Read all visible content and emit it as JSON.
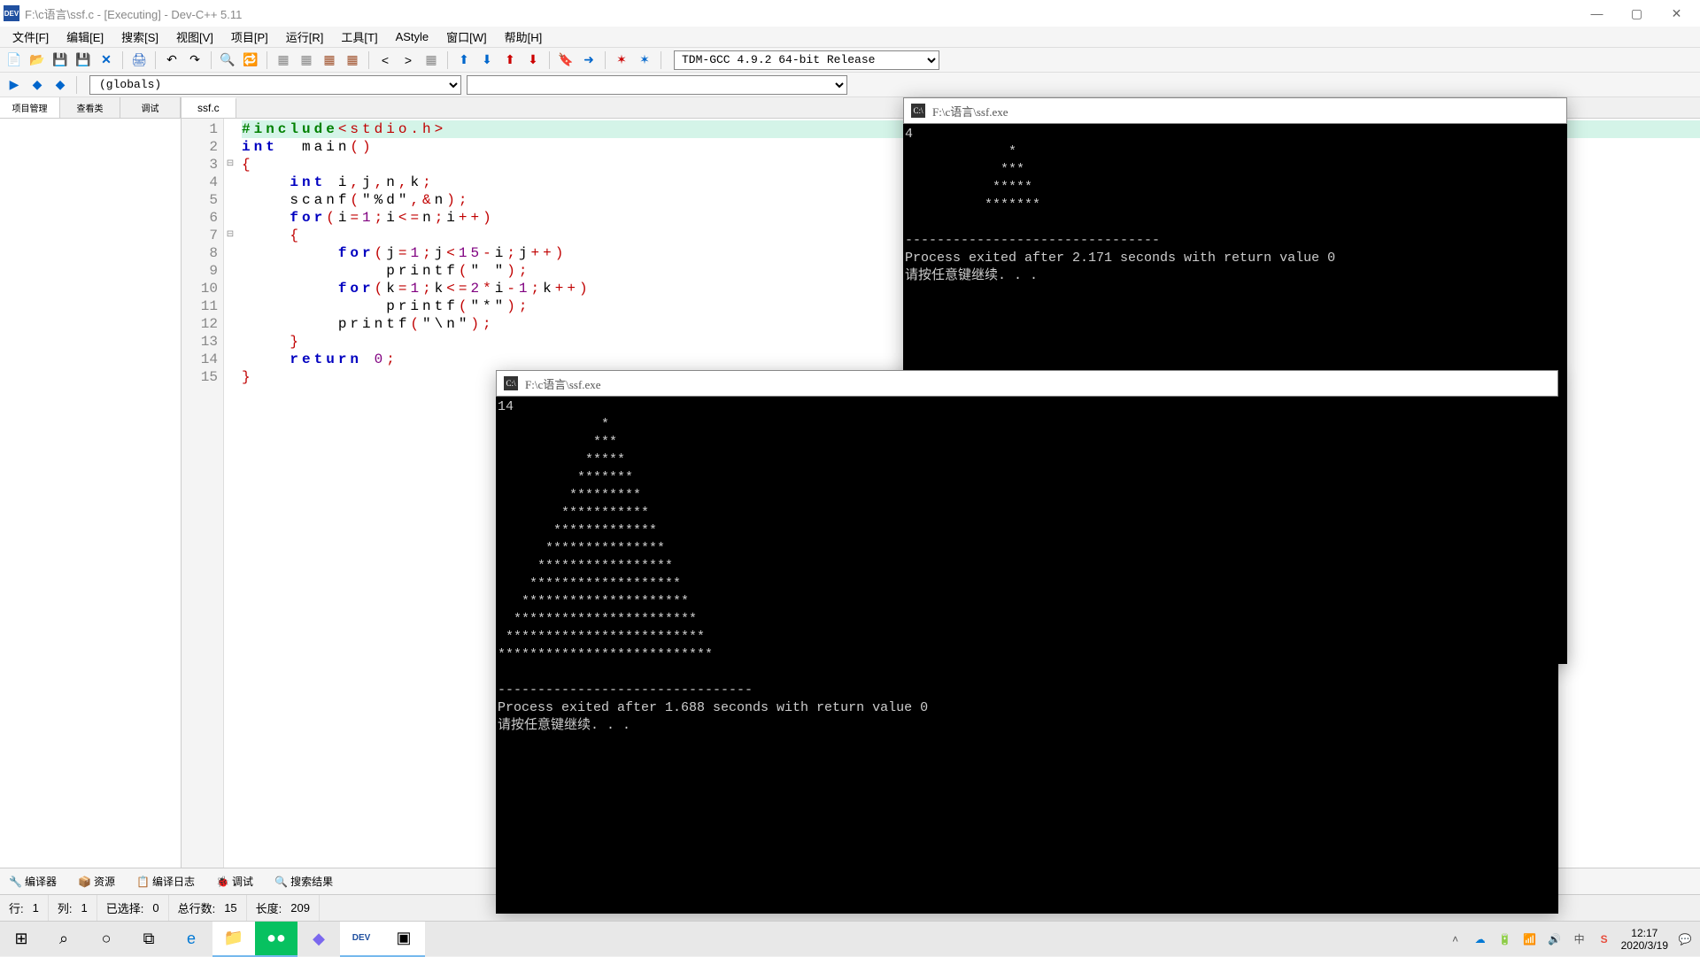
{
  "title": "F:\\c语言\\ssf.c - [Executing] - Dev-C++ 5.11",
  "menu": [
    "文件[F]",
    "编辑[E]",
    "搜索[S]",
    "视图[V]",
    "项目[P]",
    "运行[R]",
    "工具[T]",
    "AStyle",
    "窗口[W]",
    "帮助[H]"
  ],
  "compiler": "TDM-GCC 4.9.2 64-bit Release",
  "globals": "(globals)",
  "sidebar_tabs": [
    "项目管理",
    "查看类",
    "调试"
  ],
  "file_tab": "ssf.c",
  "code": {
    "lines": [
      {
        "n": 1,
        "html": "<span class='kw-green'>#include</span><span class='kw-red'>&lt;stdio.h&gt;</span>",
        "hl": true
      },
      {
        "n": 2,
        "html": "<span class='kw-blue'>int</span>  <span>main</span><span class='kw-red'>()</span>"
      },
      {
        "n": 3,
        "html": "<span class='kw-red'>{</span>",
        "fold": "⊟"
      },
      {
        "n": 4,
        "html": "    <span class='kw-blue'>int</span> i<span class='kw-red'>,</span>j<span class='kw-red'>,</span>n<span class='kw-red'>,</span>k<span class='kw-red'>;</span>"
      },
      {
        "n": 5,
        "html": "    scanf<span class='kw-red'>(</span><span>\"%d\"</span><span class='kw-red'>,&amp;</span>n<span class='kw-red'>);</span>"
      },
      {
        "n": 6,
        "html": "    <span class='kw-blue'>for</span><span class='kw-red'>(</span>i<span class='kw-red'>=</span><span class='kw-purple'>1</span><span class='kw-red'>;</span>i<span class='kw-red'>&lt;=</span>n<span class='kw-red'>;</span>i<span class='kw-red'>++)</span>"
      },
      {
        "n": 7,
        "html": "    <span class='kw-red'>{</span>",
        "fold": "⊟"
      },
      {
        "n": 8,
        "html": "        <span class='kw-blue'>for</span><span class='kw-red'>(</span>j<span class='kw-red'>=</span><span class='kw-purple'>1</span><span class='kw-red'>;</span>j<span class='kw-red'>&lt;</span><span class='kw-purple'>15</span><span class='kw-red'>-</span>i<span class='kw-red'>;</span>j<span class='kw-red'>++)</span>"
      },
      {
        "n": 9,
        "html": "            printf<span class='kw-red'>(</span><span>\" \"</span><span class='kw-red'>);</span>"
      },
      {
        "n": 10,
        "html": "        <span class='kw-blue'>for</span><span class='kw-red'>(</span>k<span class='kw-red'>=</span><span class='kw-purple'>1</span><span class='kw-red'>;</span>k<span class='kw-red'>&lt;=</span><span class='kw-purple'>2</span><span class='kw-red'>*</span>i<span class='kw-red'>-</span><span class='kw-purple'>1</span><span class='kw-red'>;</span>k<span class='kw-red'>++)</span>"
      },
      {
        "n": 11,
        "html": "            printf<span class='kw-red'>(</span><span>\"*\"</span><span class='kw-red'>);</span>"
      },
      {
        "n": 12,
        "html": "        printf<span class='kw-red'>(</span><span>\"\\n\"</span><span class='kw-red'>);</span>"
      },
      {
        "n": 13,
        "html": "    <span class='kw-red'>}</span>"
      },
      {
        "n": 14,
        "html": "    <span class='kw-blue'>return</span> <span class='kw-purple'>0</span><span class='kw-red'>;</span>"
      },
      {
        "n": 15,
        "html": "<span class='kw-red'>}</span>"
      }
    ]
  },
  "bottom_tabs": [
    "编译器",
    "资源",
    "编译日志",
    "调试",
    "搜索结果"
  ],
  "status": {
    "line_lbl": "行:",
    "line": "1",
    "col_lbl": "列:",
    "col": "1",
    "sel_lbl": "已选择:",
    "sel": "0",
    "total_lbl": "总行数:",
    "total": "15",
    "len_lbl": "长度:",
    "len": "209"
  },
  "console1": {
    "title": "F:\\c语言\\ssf.exe",
    "body": "4\n             *\n            ***\n           *****\n          *******\n\n--------------------------------\nProcess exited after 2.171 seconds with return value 0\n请按任意键继续. . ."
  },
  "console2": {
    "title": "F:\\c语言\\ssf.exe",
    "body": "14\n             *\n            ***\n           *****\n          *******\n         *********\n        ***********\n       *************\n      ***************\n     *****************\n    *******************\n   *********************\n  ***********************\n *************************\n***************************\n\n--------------------------------\nProcess exited after 1.688 seconds with return value 0\n请按任意键继续. . ."
  },
  "taskbar": {
    "time": "12:17",
    "date": "2020/3/19"
  }
}
